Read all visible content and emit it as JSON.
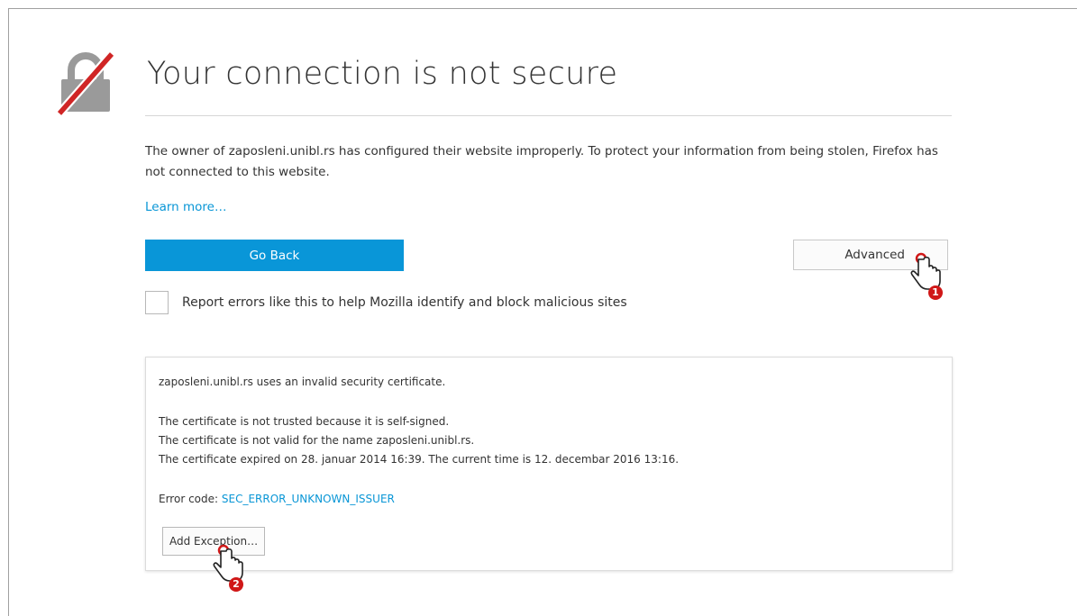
{
  "page": {
    "title": "Your connection is not secure",
    "description": "The owner of zaposleni.unibl.rs has configured their website improperly. To protect your information from being stolen, Firefox has not connected to this website.",
    "learn_more": "Learn more…",
    "go_back_label": "Go Back",
    "advanced_label": "Advanced",
    "report_label": "Report errors like this to help Mozilla identify and block malicious sites",
    "report_checked": false
  },
  "details": {
    "summary": "zaposleni.unibl.rs uses an invalid security certificate.",
    "reasons": [
      "The certificate is not trusted because it is self-signed.",
      "The certificate is not valid for the name zaposleni.unibl.rs.",
      "The certificate expired on 28. januar 2014 16:39. The current time is 12. decembar 2016 13:16."
    ],
    "error_code_label": "Error code: ",
    "error_code": "SEC_ERROR_UNKNOWN_ISSUER",
    "add_exception_label": "Add Exception…"
  },
  "annotations": [
    {
      "number": "1",
      "target": "Advanced"
    },
    {
      "number": "2",
      "target": "Add Exception…"
    }
  ],
  "colors": {
    "accent": "#0996d8",
    "link": "#0996d6",
    "marker": "#d01818",
    "lock_slash": "#d02525",
    "lock_body": "#9a9a9a"
  },
  "icons": {
    "lock": "broken-lock-icon",
    "cursor": "hand-pointer-icon"
  }
}
